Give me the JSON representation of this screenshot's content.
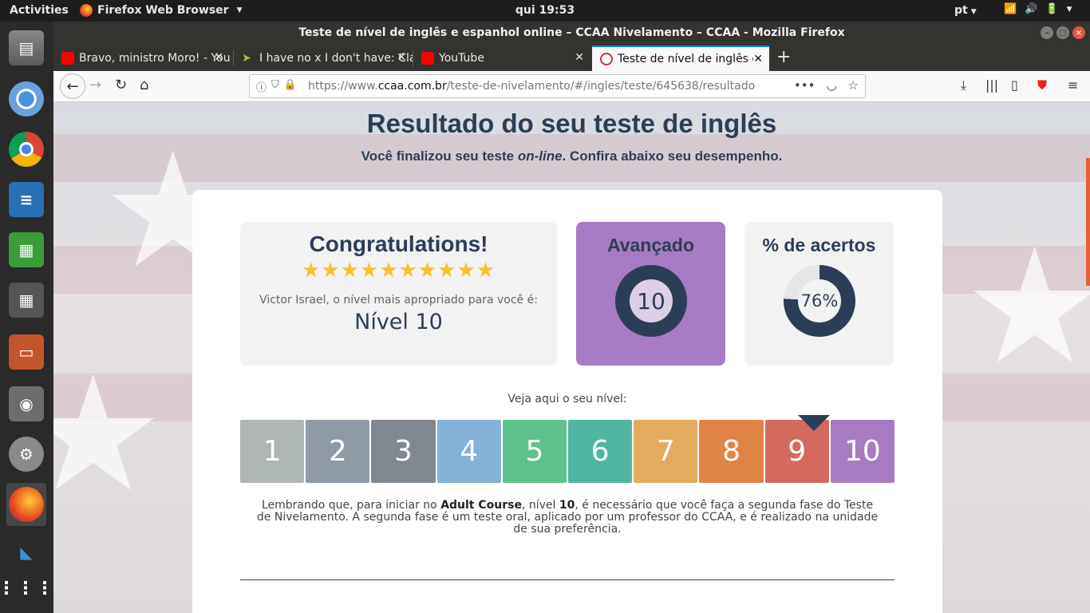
{
  "topbar": {
    "activities": "Activities",
    "app_name": "Firefox Web Browser",
    "clock": "qui 19:53",
    "lang": "pt"
  },
  "window": {
    "title": "Teste de nível de inglês e espanhol online – CCAA Nivelamento – CCAA - Mozilla Firefox"
  },
  "tabs": [
    {
      "label": "Bravo, ministro Moro! - YouTube",
      "favicon": "youtube-icon"
    },
    {
      "label": "I have no x I don't have: Clarify",
      "favicon": "arrow-icon"
    },
    {
      "label": "YouTube",
      "favicon": "youtube-icon"
    },
    {
      "label": "Teste de nível de inglês e espanhol",
      "favicon": "ccaa-icon"
    }
  ],
  "urlbar": {
    "prefix": "https://www.",
    "domain": "ccaa.com.br",
    "path": "/teste-de-nivelamento/#/ingles/teste/645638/resultado"
  },
  "page": {
    "heading": "Resultado do seu teste de inglês",
    "subtitle_a": "Você finalizou seu teste ",
    "subtitle_em": "on-line",
    "subtitle_b": ". Confira abaixo seu desempenho.",
    "congrats_title": "Congratulations!",
    "stars": "★★★★★★★★★★",
    "stars_count": 10,
    "congrats_text": "Victor Israel, o nível mais apropriado para você é:",
    "level_label": "Nível 10",
    "advanced_title": "Avançado",
    "advanced_value": "10",
    "pct_title": "% de acertos",
    "pct_value": "76%",
    "pct_fraction": 0.76,
    "levels_caption": "Veja aqui o seu nível:",
    "levels": [
      "1",
      "2",
      "3",
      "4",
      "5",
      "6",
      "7",
      "8",
      "9",
      "10"
    ],
    "level_colors": [
      "#aeb6b6",
      "#8e9ba7",
      "#7f8891",
      "#84b1d8",
      "#5fc18b",
      "#4fb5a0",
      "#e2ab5e",
      "#e08446",
      "#d46a5f",
      "#a77bc3"
    ],
    "current_level": 10,
    "note_a": "Lembrando que, para iniciar no ",
    "note_b1": "Adult Course",
    "note_c": ", nível ",
    "note_b2": "10",
    "note_d": ", é necessário que você faça a segunda fase do Teste de Nivelamento. A segunda fase é um teste oral, aplicado por um professor do CCAA, e é realizado na unidade de sua preferência."
  },
  "colors": {
    "navy": "#2c3e57",
    "purple": "#a77bc3",
    "star": "#f5c22e"
  }
}
